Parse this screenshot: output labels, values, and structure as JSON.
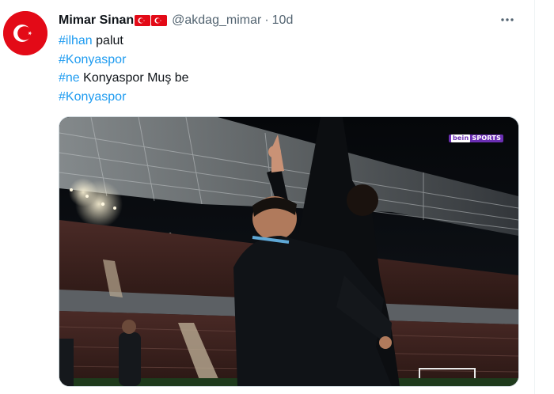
{
  "tweet": {
    "author_name": "Mimar Sinan",
    "handle": "@akdag_mimar",
    "separator": "·",
    "timestamp": "10d",
    "more_icon": "more-horizontal-icon",
    "lines": [
      {
        "tag": "#ilhan",
        "text": " palut"
      },
      {
        "tag": "#Konyaspor",
        "text": ""
      },
      {
        "tag": "#ne",
        "text": " Konyaspor Muş be"
      },
      {
        "tag": "#Konyaspor",
        "text": ""
      }
    ],
    "media": {
      "broadcaster_logo_left": "bein",
      "broadcaster_logo_right": "SPORTS"
    }
  },
  "colors": {
    "hashtag": "#1d9bf0",
    "secondary_text": "#536471",
    "flag_red": "#e30a17"
  }
}
